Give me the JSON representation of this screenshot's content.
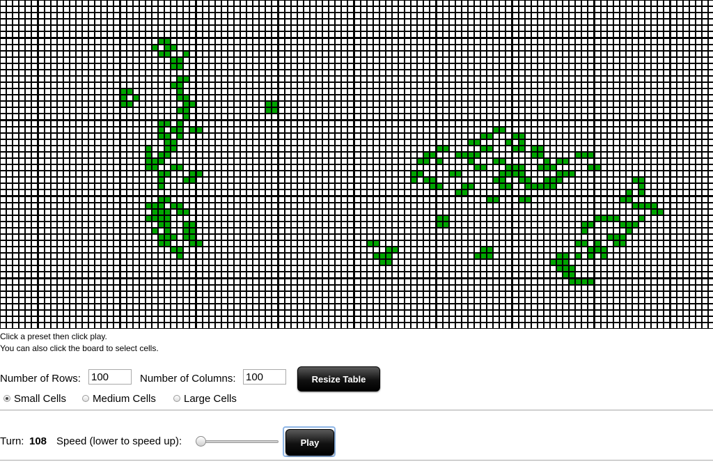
{
  "board": {
    "rows": 100,
    "cols": 100,
    "cell_size": "small",
    "alive_color": "#00a500",
    "live_cells": [
      [
        6,
        25
      ],
      [
        6,
        26
      ],
      [
        7,
        24
      ],
      [
        7,
        26
      ],
      [
        7,
        27
      ],
      [
        8,
        25
      ],
      [
        8,
        26
      ],
      [
        8,
        29
      ],
      [
        9,
        27
      ],
      [
        9,
        28
      ],
      [
        10,
        27
      ],
      [
        10,
        28
      ],
      [
        12,
        28
      ],
      [
        12,
        29
      ],
      [
        13,
        27
      ],
      [
        13,
        28
      ],
      [
        14,
        19
      ],
      [
        14,
        20
      ],
      [
        14,
        28
      ],
      [
        15,
        19
      ],
      [
        15,
        21
      ],
      [
        15,
        28
      ],
      [
        15,
        29
      ],
      [
        16,
        19
      ],
      [
        16,
        20
      ],
      [
        16,
        29
      ],
      [
        16,
        30
      ],
      [
        17,
        28
      ],
      [
        17,
        29
      ],
      [
        16,
        42
      ],
      [
        16,
        43
      ],
      [
        17,
        42
      ],
      [
        17,
        43
      ],
      [
        18,
        29
      ],
      [
        19,
        25
      ],
      [
        19,
        26
      ],
      [
        19,
        28
      ],
      [
        20,
        25
      ],
      [
        20,
        27
      ],
      [
        20,
        28
      ],
      [
        20,
        30
      ],
      [
        20,
        31
      ],
      [
        21,
        25
      ],
      [
        21,
        26
      ],
      [
        21,
        28
      ],
      [
        22,
        26
      ],
      [
        22,
        27
      ],
      [
        23,
        23
      ],
      [
        23,
        26
      ],
      [
        23,
        27
      ],
      [
        24,
        23
      ],
      [
        24,
        25
      ],
      [
        24,
        26
      ],
      [
        25,
        23
      ],
      [
        25,
        24
      ],
      [
        25,
        25
      ],
      [
        26,
        23
      ],
      [
        26,
        24
      ],
      [
        26,
        27
      ],
      [
        26,
        28
      ],
      [
        27,
        25
      ],
      [
        27,
        26
      ],
      [
        27,
        30
      ],
      [
        27,
        31
      ],
      [
        28,
        25
      ],
      [
        28,
        29
      ],
      [
        28,
        30
      ],
      [
        29,
        25
      ],
      [
        31,
        25
      ],
      [
        31,
        26
      ],
      [
        32,
        23
      ],
      [
        32,
        24
      ],
      [
        32,
        25
      ],
      [
        32,
        27
      ],
      [
        32,
        28
      ],
      [
        33,
        24
      ],
      [
        33,
        25
      ],
      [
        33,
        26
      ],
      [
        33,
        28
      ],
      [
        33,
        29
      ],
      [
        34,
        23
      ],
      [
        34,
        24
      ],
      [
        34,
        25
      ],
      [
        34,
        26
      ],
      [
        35,
        25
      ],
      [
        35,
        26
      ],
      [
        35,
        29
      ],
      [
        35,
        30
      ],
      [
        36,
        24
      ],
      [
        36,
        26
      ],
      [
        36,
        29
      ],
      [
        36,
        30
      ],
      [
        37,
        25
      ],
      [
        37,
        26
      ],
      [
        37,
        27
      ],
      [
        37,
        29
      ],
      [
        37,
        30
      ],
      [
        38,
        25
      ],
      [
        38,
        26
      ],
      [
        38,
        30
      ],
      [
        38,
        31
      ],
      [
        39,
        27
      ],
      [
        39,
        28
      ],
      [
        40,
        28
      ],
      [
        20,
        78
      ],
      [
        20,
        79
      ],
      [
        21,
        76
      ],
      [
        21,
        77
      ],
      [
        21,
        81
      ],
      [
        21,
        82
      ],
      [
        22,
        74
      ],
      [
        22,
        75
      ],
      [
        22,
        80
      ],
      [
        22,
        82
      ],
      [
        23,
        69
      ],
      [
        23,
        70
      ],
      [
        23,
        76
      ],
      [
        23,
        77
      ],
      [
        23,
        81
      ],
      [
        23,
        82
      ],
      [
        23,
        84
      ],
      [
        23,
        85
      ],
      [
        24,
        67
      ],
      [
        24,
        68
      ],
      [
        24,
        72
      ],
      [
        24,
        73
      ],
      [
        24,
        74
      ],
      [
        24,
        75
      ],
      [
        24,
        84
      ],
      [
        24,
        85
      ],
      [
        24,
        91
      ],
      [
        24,
        92
      ],
      [
        24,
        93
      ],
      [
        25,
        66
      ],
      [
        25,
        67
      ],
      [
        25,
        69
      ],
      [
        25,
        74
      ],
      [
        25,
        78
      ],
      [
        25,
        79
      ],
      [
        25,
        86
      ],
      [
        25,
        88
      ],
      [
        25,
        89
      ],
      [
        26,
        75
      ],
      [
        26,
        76
      ],
      [
        26,
        80
      ],
      [
        26,
        81
      ],
      [
        26,
        82
      ],
      [
        26,
        85
      ],
      [
        26,
        86
      ],
      [
        26,
        87
      ],
      [
        26,
        93
      ],
      [
        26,
        94
      ],
      [
        27,
        65
      ],
      [
        27,
        66
      ],
      [
        27,
        71
      ],
      [
        27,
        72
      ],
      [
        27,
        79
      ],
      [
        27,
        80
      ],
      [
        27,
        81
      ],
      [
        27,
        82
      ],
      [
        27,
        88
      ],
      [
        27,
        89
      ],
      [
        27,
        90
      ],
      [
        28,
        65
      ],
      [
        28,
        67
      ],
      [
        28,
        68
      ],
      [
        28,
        78
      ],
      [
        28,
        79
      ],
      [
        28,
        82
      ],
      [
        28,
        83
      ],
      [
        28,
        86
      ],
      [
        28,
        87
      ],
      [
        28,
        88
      ],
      [
        28,
        100
      ],
      [
        28,
        101
      ],
      [
        29,
        68
      ],
      [
        29,
        69
      ],
      [
        29,
        73
      ],
      [
        29,
        74
      ],
      [
        29,
        79
      ],
      [
        29,
        80
      ],
      [
        29,
        83
      ],
      [
        29,
        84
      ],
      [
        29,
        85
      ],
      [
        29,
        86
      ],
      [
        29,
        87
      ],
      [
        29,
        101
      ],
      [
        30,
        72
      ],
      [
        30,
        73
      ],
      [
        30,
        99
      ],
      [
        30,
        101
      ],
      [
        31,
        77
      ],
      [
        31,
        78
      ],
      [
        31,
        82
      ],
      [
        31,
        83
      ],
      [
        31,
        98
      ],
      [
        31,
        99
      ],
      [
        32,
        100
      ],
      [
        32,
        101
      ],
      [
        32,
        102
      ],
      [
        32,
        103
      ],
      [
        33,
        103
      ],
      [
        33,
        104
      ],
      [
        34,
        69
      ],
      [
        34,
        70
      ],
      [
        34,
        94
      ],
      [
        34,
        95
      ],
      [
        34,
        96
      ],
      [
        34,
        97
      ],
      [
        34,
        101
      ],
      [
        35,
        69
      ],
      [
        35,
        70
      ],
      [
        35,
        92
      ],
      [
        35,
        93
      ],
      [
        35,
        98
      ],
      [
        35,
        99
      ],
      [
        35,
        100
      ],
      [
        36,
        92
      ],
      [
        36,
        99
      ],
      [
        37,
        96
      ],
      [
        37,
        97
      ],
      [
        37,
        98
      ],
      [
        38,
        58
      ],
      [
        38,
        59
      ],
      [
        38,
        91
      ],
      [
        38,
        92
      ],
      [
        38,
        94
      ],
      [
        38,
        97
      ],
      [
        38,
        98
      ],
      [
        39,
        61
      ],
      [
        39,
        62
      ],
      [
        39,
        76
      ],
      [
        39,
        77
      ],
      [
        39,
        93
      ],
      [
        39,
        94
      ],
      [
        39,
        95
      ],
      [
        40,
        59
      ],
      [
        40,
        60
      ],
      [
        40,
        61
      ],
      [
        40,
        75
      ],
      [
        40,
        76
      ],
      [
        40,
        77
      ],
      [
        40,
        88
      ],
      [
        40,
        89
      ],
      [
        40,
        91
      ],
      [
        40,
        93
      ],
      [
        40,
        95
      ],
      [
        41,
        60
      ],
      [
        41,
        61
      ],
      [
        41,
        87
      ],
      [
        41,
        88
      ],
      [
        41,
        89
      ],
      [
        42,
        88
      ],
      [
        42,
        89
      ],
      [
        42,
        90
      ],
      [
        43,
        89
      ],
      [
        43,
        90
      ],
      [
        44,
        90
      ],
      [
        44,
        91
      ],
      [
        44,
        92
      ],
      [
        44,
        93
      ]
    ]
  },
  "instructions": {
    "line1": "Click a preset then click play.",
    "line2": "You can also click the board to select cells."
  },
  "controls": {
    "rows_label": "Number of Rows:",
    "rows_value": "100",
    "cols_label": "Number of Columns:",
    "cols_value": "100",
    "resize_label": "Resize Table",
    "size_options": [
      {
        "label": "Small Cells",
        "checked": true
      },
      {
        "label": "Medium Cells",
        "checked": false
      },
      {
        "label": "Large Cells",
        "checked": false
      }
    ]
  },
  "status": {
    "turn_label": "Turn:",
    "turn_value": "108",
    "speed_label": "Speed (lower to speed up):",
    "speed_fraction": 0.0,
    "play_label": "Play"
  }
}
